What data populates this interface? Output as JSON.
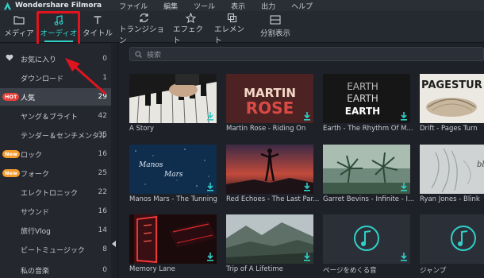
{
  "app": {
    "title": "Wondershare Filmora"
  },
  "menu": [
    "ファイル",
    "編集",
    "ツール",
    "表示",
    "出力",
    "ヘルプ"
  ],
  "toolbar": {
    "tools": [
      {
        "label": "メディア",
        "icon": "folder-icon"
      },
      {
        "label": "オーディオ",
        "icon": "music-note-icon",
        "active": true
      },
      {
        "label": "タイトル",
        "icon": "text-icon"
      },
      {
        "label": "トランジション",
        "icon": "transition-icon"
      },
      {
        "label": "エフェクト",
        "icon": "effect-icon"
      },
      {
        "label": "エレメント",
        "icon": "element-icon"
      },
      {
        "label": "分割表示",
        "icon": "split-screen-icon"
      }
    ]
  },
  "sidebar": {
    "items": [
      {
        "label": "お気に入り",
        "count": "0",
        "icon": "heart-icon"
      },
      {
        "label": "ダウンロード",
        "count": "1"
      },
      {
        "label": "人気",
        "count": "29",
        "badge": "HOT",
        "active": true
      },
      {
        "label": "ヤング＆ブライト",
        "count": "42"
      },
      {
        "label": "テンダー＆センチメンタル",
        "count": "35"
      },
      {
        "label": "ロック",
        "count": "16",
        "badge": "New"
      },
      {
        "label": "フォーク",
        "count": "25",
        "badge": "New"
      },
      {
        "label": "エレクトロニック",
        "count": "22"
      },
      {
        "label": "サウンド",
        "count": "16"
      },
      {
        "label": "旅行Vlog",
        "count": "14"
      },
      {
        "label": "ビートミュージック",
        "count": "8"
      },
      {
        "label": "私の音楽",
        "count": "0"
      }
    ]
  },
  "search": {
    "placeholder": "検索"
  },
  "media": [
    {
      "title": "A Story"
    },
    {
      "title": "Martin Rose - Riding On",
      "art_text": [
        "MARTIN",
        "ROSE"
      ]
    },
    {
      "title": "Earth - The Rhythm Of M...",
      "art_text": [
        "EARTH",
        "EARTH",
        "EARTH"
      ]
    },
    {
      "title": "Drift - Pages Turn",
      "art_text": [
        "PAGESTUR"
      ]
    },
    {
      "title": "Manos Mars - The Tunning",
      "art_text": [
        "Manos",
        "Mars"
      ]
    },
    {
      "title": "Red Echoes - The Last Par..."
    },
    {
      "title": "Garret Bevins - Infinite - I..."
    },
    {
      "title": "Ryan Jones - Blink",
      "art_text": [
        "blink"
      ]
    },
    {
      "title": "Memory Lane"
    },
    {
      "title": "Trip of A Lifetime"
    },
    {
      "title": "ページをめくる音",
      "icon": "audio-file-icon"
    },
    {
      "title": "ジャンプ",
      "icon": "audio-file-icon"
    }
  ],
  "colors": {
    "accent": "#2fd0c8",
    "highlight": "#e0141e",
    "hot": "#e5413a",
    "new": "#f29a2e",
    "background": "#1e2128"
  }
}
